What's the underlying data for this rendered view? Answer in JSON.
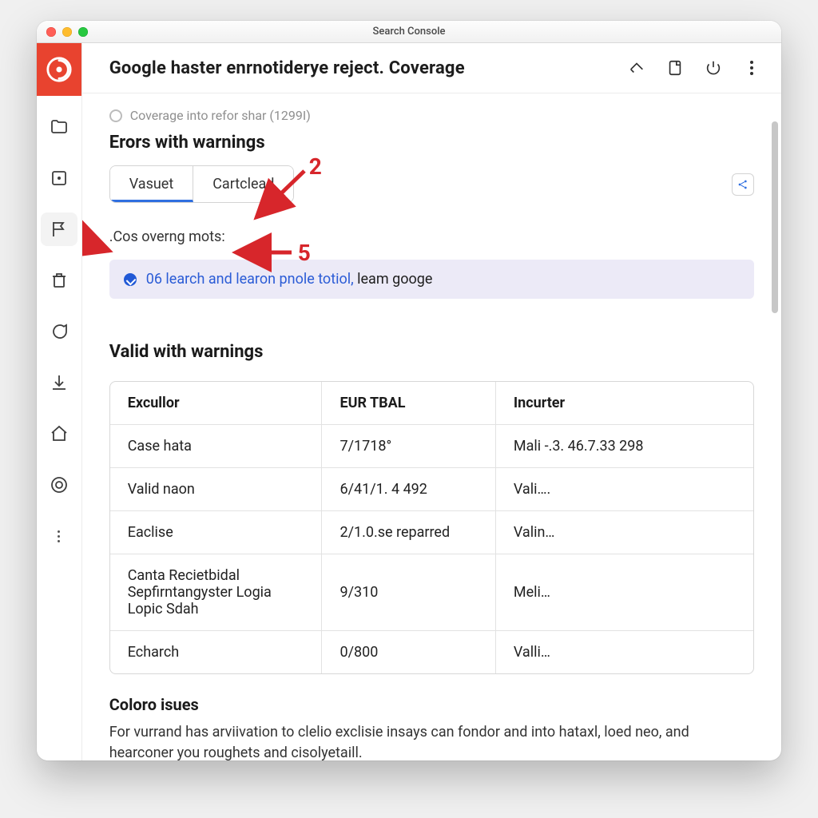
{
  "window": {
    "title": "Search Console"
  },
  "toolbar": {
    "title": "Google haster enrnotiderye reject. Coverage"
  },
  "coverage_line": "Coverage into refor shar (1299I)",
  "section_errors": "Erors with warnings",
  "tabs": {
    "a": "Vasuet",
    "b": "Cartclead"
  },
  "subtext": ".Cos overng mots:",
  "banner": {
    "link": "06 learch and learon pnole totiol,",
    "rest": " leam googe"
  },
  "section_valid": "Valid with warnings",
  "table": {
    "headers": {
      "c1": "Excullor",
      "c2": "EUR TBAL",
      "c3": "Incurter"
    },
    "rows": [
      {
        "c1": "Case hata",
        "c2": "7/1718°",
        "c3": "Mali -.3. 46.7.33 298"
      },
      {
        "c1": "Valid naon",
        "c2": "6/41/1. 4 492",
        "c3": "Vali…."
      },
      {
        "c1": "Eaclise",
        "c2": "2/1.0.se reparred",
        "c3": "Valin…"
      },
      {
        "c1": "Canta Recietbidal Sepfirntangyster Logia Lopic Sdah",
        "c2": "9/310",
        "c3": "Meli…"
      },
      {
        "c1": "Echarch",
        "c2": "0/800",
        "c3": "Valli…"
      }
    ]
  },
  "footer": {
    "h": "Coloro isues",
    "p": "For vurrand has arviivation to clelio exclisie insays can fondor and into hataxl, loed neo, and hearconer you roughets and cisolyetaill."
  },
  "annotations": {
    "n1": "2",
    "n2": "5"
  }
}
